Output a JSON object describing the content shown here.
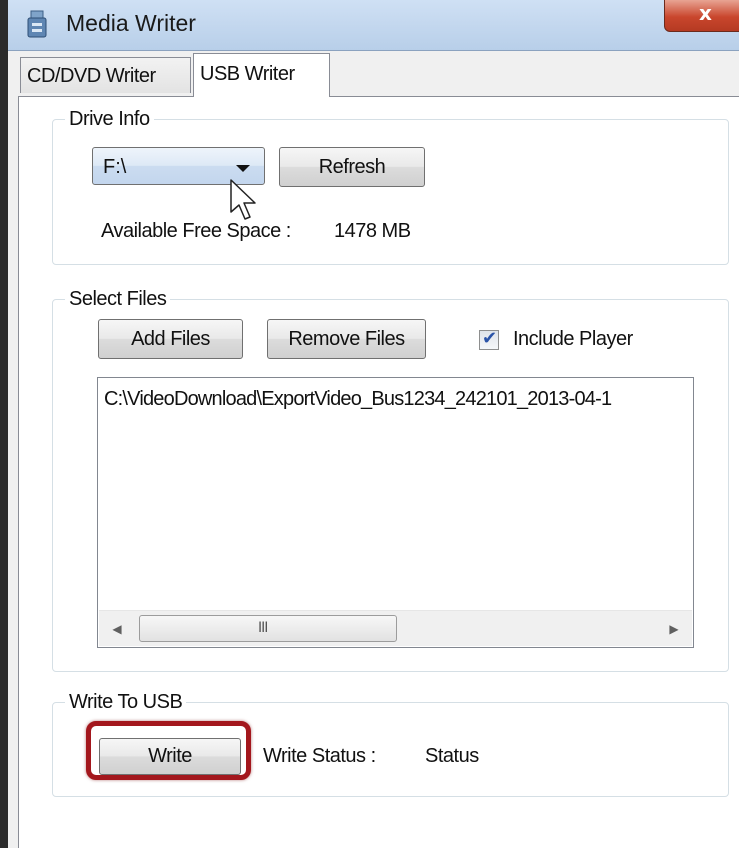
{
  "window": {
    "title": "Media Writer",
    "close_label": "x",
    "icon": "usb-drive-icon"
  },
  "tabs": [
    {
      "label": "CD/DVD Writer",
      "selected": false
    },
    {
      "label": "USB Writer",
      "selected": true
    }
  ],
  "drive_info": {
    "legend": "Drive Info",
    "drive_selected": "F:\\",
    "refresh_label": "Refresh",
    "free_space_label": "Available Free Space :",
    "free_space_value": "1478 MB"
  },
  "select_files": {
    "legend": "Select Files",
    "add_label": "Add Files",
    "remove_label": "Remove Files",
    "include_player_label": "Include Player",
    "include_player_checked": true,
    "files": [
      "C:\\VideoDownload\\ExportVideo_Bus1234_242101_2013-04-1"
    ],
    "scroll_grip": "III"
  },
  "write_to_usb": {
    "legend": "Write To USB",
    "write_label": "Write",
    "status_label": "Write Status :",
    "status_value": "Status"
  },
  "colors": {
    "highlight": "#a3171d",
    "close_button": "#c9462d",
    "checkmark": "#2b54a8"
  }
}
